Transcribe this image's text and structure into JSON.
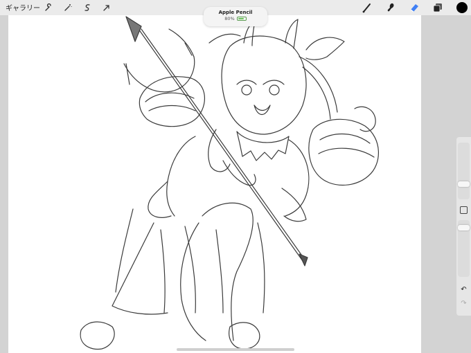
{
  "topbar": {
    "gallery_label": "ギャラリー",
    "left_tools": [
      "wrench-icon",
      "magic-wand-icon",
      "selection-icon",
      "transform-arrow-icon"
    ],
    "right_tools": [
      "brush-icon",
      "smudge-icon",
      "eraser-icon",
      "layers-icon"
    ],
    "current_color": "#000000",
    "active_tool_color": "#3f7ff5"
  },
  "pencil_popup": {
    "title": "Apple Pencil",
    "battery_text": "80%",
    "battery_level": 0.8,
    "battery_color": "#6cc45a"
  },
  "sidebar": {
    "size_slider_level": 0.25,
    "opacity_slider_level": 0.9
  }
}
